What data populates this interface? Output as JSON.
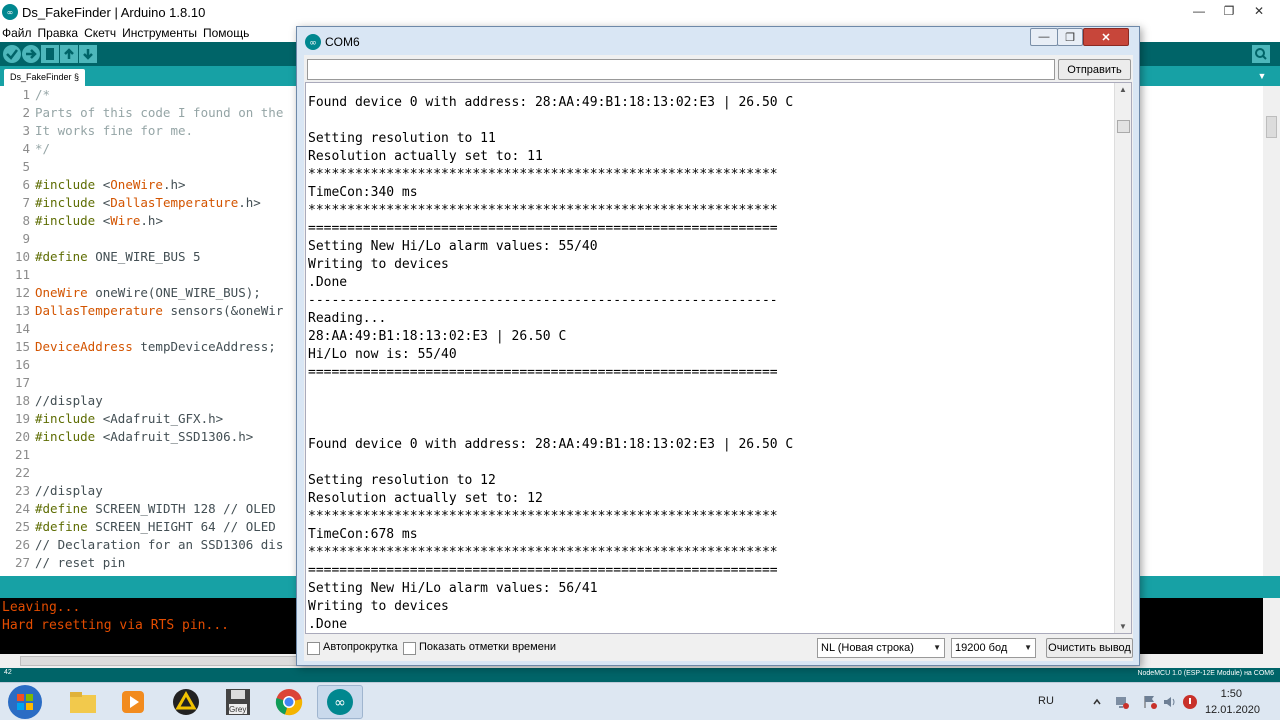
{
  "ide": {
    "title": "Ds_FakeFinder | Arduino 1.8.10",
    "window_controls": {
      "minimize": "—",
      "restore": "❐",
      "close": "✕"
    },
    "menu": [
      "Файл",
      "Правка",
      "Скетч",
      "Инструменты",
      "Помощь"
    ],
    "tab": "Ds_FakeFinder §",
    "code_lines": [
      {
        "n": "1",
        "t": "/*",
        "c": "comment"
      },
      {
        "n": "2",
        "t": "Parts of this code I found on the",
        "c": "comment"
      },
      {
        "n": "3",
        "t": "It works fine for me.",
        "c": "comment"
      },
      {
        "n": "4",
        "t": "*/",
        "c": "comment"
      },
      {
        "n": "5",
        "t": "",
        "c": "plain"
      },
      {
        "n": "6",
        "t": "#include <OneWire.h>",
        "c": "include",
        "kw": "#include",
        "lib": "OneWire",
        "rest": ".h>"
      },
      {
        "n": "7",
        "t": "#include <DallasTemperature.h>",
        "c": "include",
        "kw": "#include",
        "lib": "DallasTemperature",
        "rest": ".h>"
      },
      {
        "n": "8",
        "t": "#include <Wire.h>",
        "c": "include",
        "kw": "#include",
        "lib": "Wire",
        "rest": ".h>"
      },
      {
        "n": "9",
        "t": "",
        "c": "plain"
      },
      {
        "n": "10",
        "t": "#define ONE_WIRE_BUS 5",
        "c": "define",
        "kw": "#define",
        "rest": " ONE_WIRE_BUS 5"
      },
      {
        "n": "11",
        "t": "",
        "c": "plain"
      },
      {
        "n": "12",
        "t": "OneWire oneWire(ONE_WIRE_BUS);",
        "c": "typed",
        "type": "OneWire",
        "rest": " oneWire(ONE_WIRE_BUS);"
      },
      {
        "n": "13",
        "t": "DallasTemperature sensors(&oneWir",
        "c": "typed",
        "type": "DallasTemperature",
        "rest": " sensors(&oneWir"
      },
      {
        "n": "14",
        "t": "",
        "c": "plain"
      },
      {
        "n": "15",
        "t": "DeviceAddress tempDeviceAddress;",
        "c": "typed",
        "type": "DeviceAddress",
        "rest": " tempDeviceAddress;"
      },
      {
        "n": "16",
        "t": "",
        "c": "plain"
      },
      {
        "n": "17",
        "t": "",
        "c": "plain"
      },
      {
        "n": "18",
        "t": "//display",
        "c": "plain"
      },
      {
        "n": "19",
        "t": "#include <Adafruit_GFX.h>",
        "c": "include2",
        "kw": "#include",
        "rest": " <Adafruit_GFX.h>"
      },
      {
        "n": "20",
        "t": "#include <Adafruit_SSD1306.h>",
        "c": "include2",
        "kw": "#include",
        "rest": " <Adafruit_SSD1306.h>"
      },
      {
        "n": "21",
        "t": "",
        "c": "plain"
      },
      {
        "n": "22",
        "t": "",
        "c": "plain"
      },
      {
        "n": "23",
        "t": "//display",
        "c": "plain"
      },
      {
        "n": "24",
        "t": "#define SCREEN_WIDTH 128 // OLED",
        "c": "define",
        "kw": "#define",
        "rest": " SCREEN_WIDTH 128 // OLED"
      },
      {
        "n": "25",
        "t": "#define SCREEN_HEIGHT 64 // OLED",
        "c": "define",
        "kw": "#define",
        "rest": " SCREEN_HEIGHT 64 // OLED"
      },
      {
        "n": "26",
        "t": "// Declaration for an SSD1306 dis",
        "c": "plain"
      },
      {
        "n": "27",
        "t": "// reset pin",
        "c": "plain"
      }
    ],
    "console_lines": [
      "Leaving...",
      "Hard resetting via RTS pin..."
    ],
    "status_line_number": "42",
    "board": "NodeMCU 1.0 (ESP-12E Module) на COM6",
    "colors": {
      "toolbar": "#006468",
      "tabbar": "#17a1a5",
      "console_text": "#e34c00"
    }
  },
  "serial_monitor": {
    "title": "COM6",
    "window_controls": {
      "minimize": "—",
      "restore": "❐",
      "close": "✕"
    },
    "input_value": "",
    "send_label": "Отправить",
    "output_lines": [
      "Found device 0 with address: 28:AA:49:B1:18:13:02:E3 | 26.50 C",
      "",
      "Setting resolution to 11",
      "Resolution actually set to: 11",
      "************************************************************",
      "TimeCon:340 ms",
      "************************************************************",
      "============================================================",
      "Setting New Hi/Lo alarm values: 55/40",
      "Writing to devices",
      ".Done",
      "------------------------------------------------------------",
      "Reading...",
      "28:AA:49:B1:18:13:02:E3 | 26.50 C",
      "Hi/Lo now is: 55/40",
      "============================================================",
      "",
      "",
      "",
      "Found device 0 with address: 28:AA:49:B1:18:13:02:E3 | 26.50 C",
      "",
      "Setting resolution to 12",
      "Resolution actually set to: 12",
      "************************************************************",
      "TimeCon:678 ms",
      "************************************************************",
      "============================================================",
      "Setting New Hi/Lo alarm values: 56/41",
      "Writing to devices",
      ".Done"
    ],
    "autoscroll_label": "Автопрокрутка",
    "timestamp_label": "Показать отметки времени",
    "line_ending": "NL (Новая строка)",
    "baud": "19200 бод",
    "clear_label": "Очистить вывод"
  },
  "taskbar": {
    "language": "RU",
    "time": "1:50",
    "date": "12.01.2020",
    "apps": [
      "windows-explorer",
      "media-player",
      "vlc-like-app",
      "grey-floppy",
      "chrome",
      "arduino"
    ],
    "floppy_label": "Grey"
  }
}
